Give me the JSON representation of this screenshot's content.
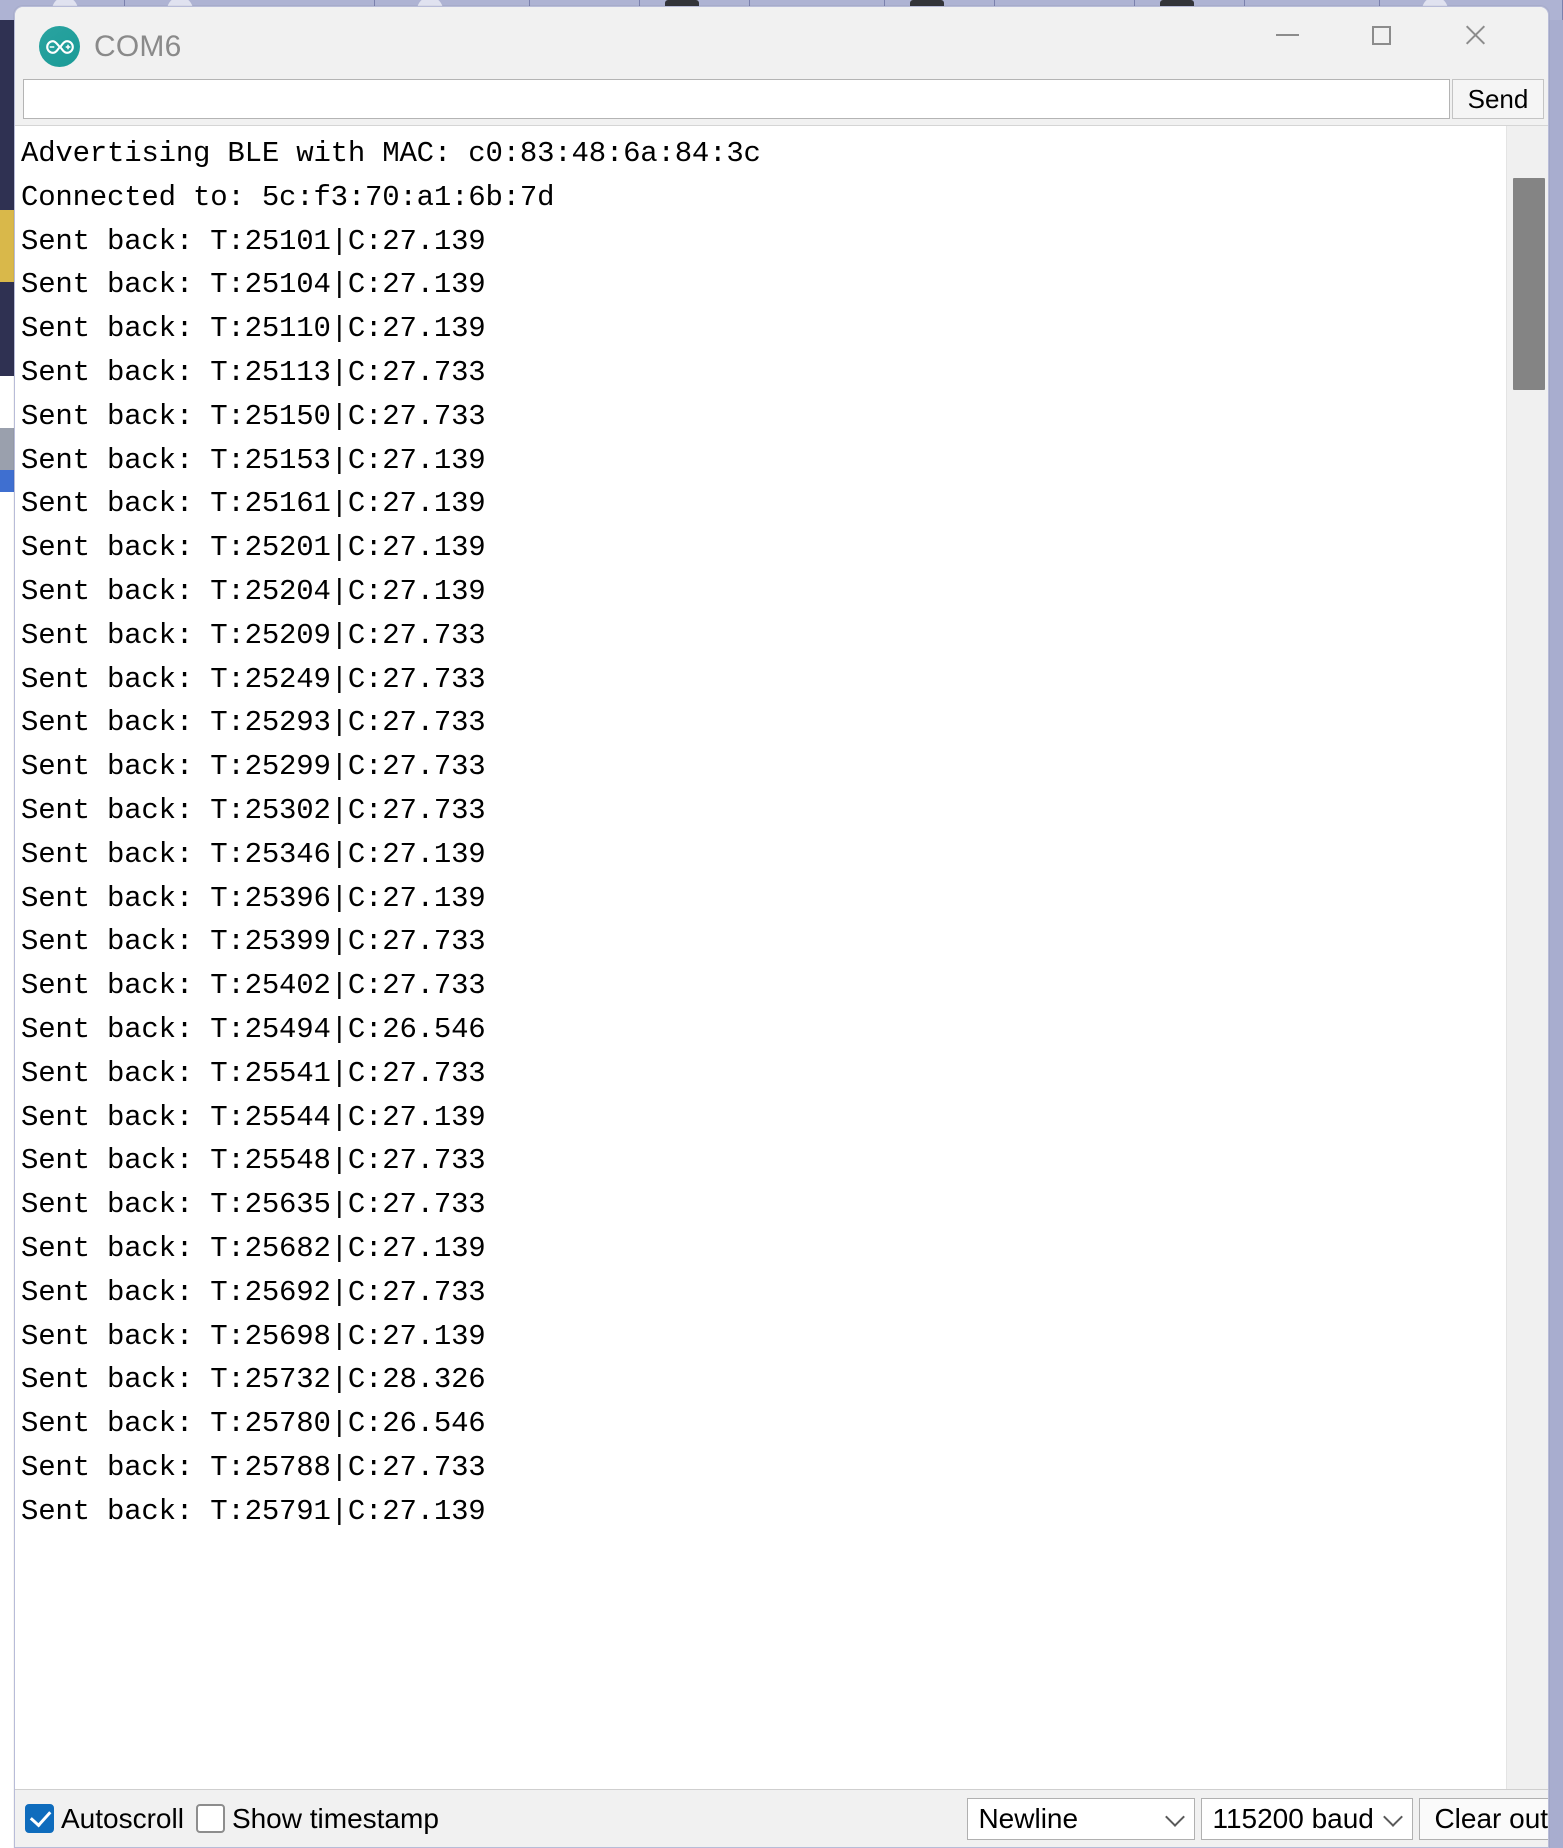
{
  "window": {
    "title": "COM6",
    "logo_icon": "arduino-infinity-icon",
    "minimize_label": "Minimize",
    "maximize_label": "Maximize",
    "close_label": "Close"
  },
  "send_row": {
    "input_value": "",
    "input_placeholder": "",
    "send_label": "Send"
  },
  "output": {
    "lines": [
      "Advertising BLE with MAC: c0:83:48:6a:84:3c",
      "Connected to: 5c:f3:70:a1:6b:7d",
      "Sent back: T:25101|C:27.139",
      "Sent back: T:25104|C:27.139",
      "Sent back: T:25110|C:27.139",
      "Sent back: T:25113|C:27.733",
      "Sent back: T:25150|C:27.733",
      "Sent back: T:25153|C:27.139",
      "Sent back: T:25161|C:27.139",
      "Sent back: T:25201|C:27.139",
      "Sent back: T:25204|C:27.139",
      "Sent back: T:25209|C:27.733",
      "Sent back: T:25249|C:27.733",
      "Sent back: T:25293|C:27.733",
      "Sent back: T:25299|C:27.733",
      "Sent back: T:25302|C:27.733",
      "Sent back: T:25346|C:27.139",
      "Sent back: T:25396|C:27.139",
      "Sent back: T:25399|C:27.733",
      "Sent back: T:25402|C:27.733",
      "Sent back: T:25494|C:26.546",
      "Sent back: T:25541|C:27.733",
      "Sent back: T:25544|C:27.139",
      "Sent back: T:25548|C:27.733",
      "Sent back: T:25635|C:27.733",
      "Sent back: T:25682|C:27.139",
      "Sent back: T:25692|C:27.733",
      "Sent back: T:25698|C:27.139",
      "Sent back: T:25732|C:28.326",
      "Sent back: T:25780|C:26.546",
      "Sent back: T:25788|C:27.733",
      "Sent back: T:25791|C:27.139"
    ],
    "scrollbar_icon": "vertical-scrollbar"
  },
  "statusbar": {
    "autoscroll_label": "Autoscroll",
    "autoscroll_checked": true,
    "show_timestamp_label": "Show timestamp",
    "show_timestamp_checked": false,
    "line_ending_value": "Newline",
    "baud_value": "115200 baud",
    "clear_output_label": "Clear output"
  },
  "colors": {
    "accent_teal": "#1a9b97",
    "checkbox_blue": "#0f6cbd",
    "scrollbar_thumb": "#848484",
    "window_chrome": "#f1f1f1",
    "desktop_background": "#a8adcf"
  }
}
